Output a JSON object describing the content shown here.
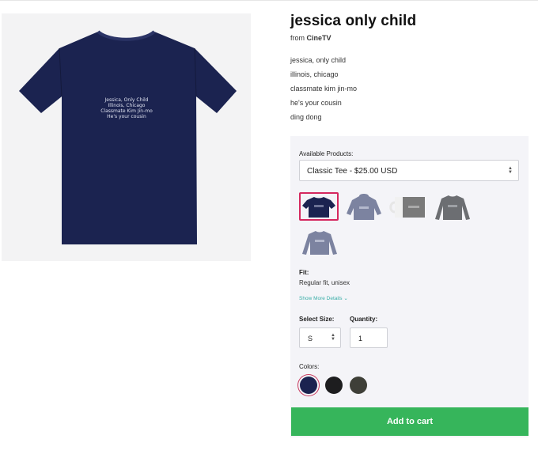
{
  "product": {
    "title": "jessica only child",
    "from_prefix": "from",
    "brand": "CineTV",
    "print_lines": [
      "Jessica, Only Child",
      "Illinois, Chicago",
      "Classmate Kim Jin-mo",
      "He's your cousin"
    ],
    "description": [
      "jessica, only child",
      "illinois, chicago",
      "classmate kim jin-mo",
      "he's your cousin",
      "ding dong"
    ]
  },
  "options": {
    "products_label": "Available Products:",
    "selected_product": "Classic Tee - $25.00 USD",
    "thumbnails": [
      "classic-tee-navy",
      "hoodie",
      "mug",
      "long-sleeve-grey",
      "sweatshirt"
    ],
    "fit_label": "Fit:",
    "fit_value": "Regular fit, unisex",
    "show_more": "Show More Details",
    "size_label": "Select Size:",
    "size_value": "S",
    "quantity_label": "Quantity:",
    "quantity_value": "1",
    "colors_label": "Colors:",
    "colors": [
      "#1b2350",
      "#1d1d1f",
      "#3e3f38"
    ],
    "selected_color_index": 0
  },
  "cart": {
    "label": "Add to cart",
    "color": "#36b55b"
  },
  "theme": {
    "accent": "#d5285f",
    "link": "#3aaea8",
    "shirt": "#1b2350"
  }
}
